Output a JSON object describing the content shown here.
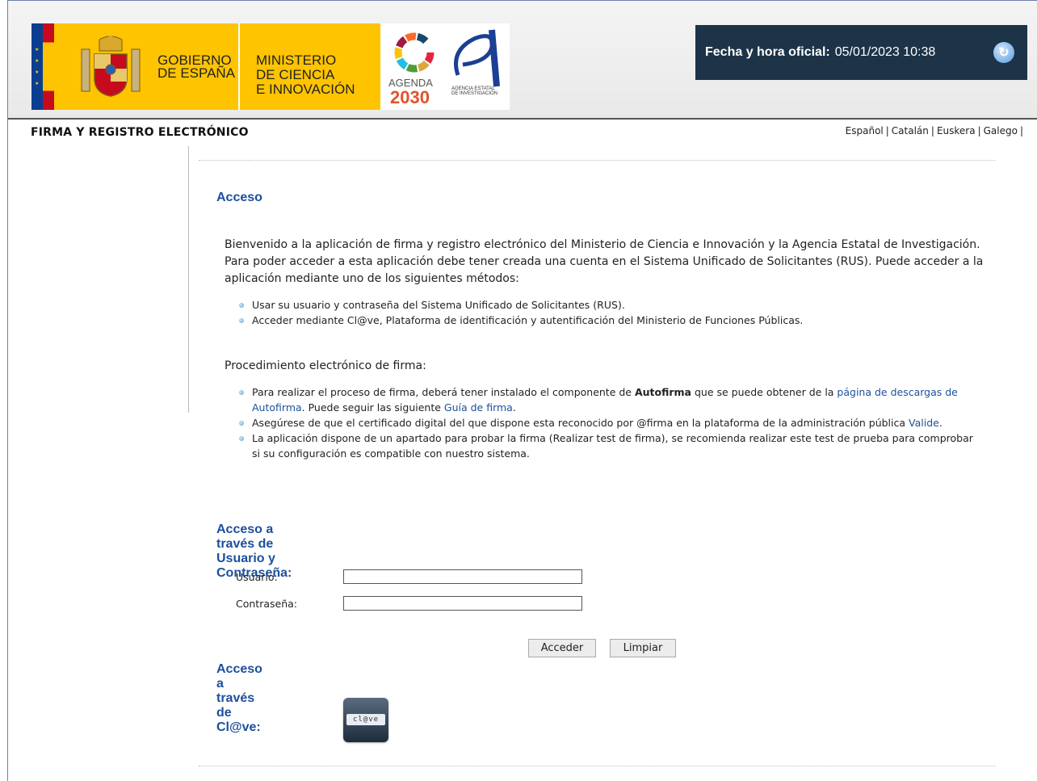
{
  "header": {
    "gobierno_line1": "GOBIERNO",
    "gobierno_line2": "DE ESPAÑA",
    "ministerio_line1": "MINISTERIO",
    "ministerio_line2": "DE CIENCIA",
    "ministerio_line3": "E INNOVACIÓN",
    "agenda_line1": "AGENDA",
    "agenda_line2": "2030",
    "aei_text": "AGENCIA ESTATAL DE INVESTIGACIÓN",
    "fecha_label": "Fecha y hora oficial:",
    "fecha_value": "05/01/2023 10:38",
    "colors": {
      "header_dark": "#1d3348",
      "brand_yellow": "#ffc400",
      "link_blue": "#1c4f9c"
    }
  },
  "title_bar": {
    "app_title": "FIRMA Y REGISTRO ELECTRÓNICO",
    "languages": [
      "Español",
      "Catalán",
      "Euskera",
      "Galego"
    ]
  },
  "main": {
    "acceso_title": "Acceso",
    "intro": "Bienvenido a la aplicación de firma y registro electrónico del Ministerio de Ciencia e Innovación y la Agencia Estatal de Investigación. Para poder acceder a esta aplicación debe tener creada una cuenta en el Sistema Unificado de Solicitantes (RUS). Puede acceder a la aplicación mediante uno de los siguientes métodos:",
    "methods": [
      "Usar su usuario y contraseña del Sistema Unificado de Solicitantes (RUS).",
      "Acceder mediante Cl@ve, Plataforma de identificación y autentificación del Ministerio de Funciones Públicas."
    ],
    "procedimiento_title": "Procedimiento electrónico de firma:",
    "proc_items": {
      "item1_a": "Para realizar el proceso de firma, deberá tener instalado el componente de ",
      "item1_bold": "Autofirma",
      "item1_b": " que se puede obtener de la ",
      "item1_link1": "página de descargas de Autofirma",
      "item1_c": ". Puede seguir las siguiente ",
      "item1_link2": "Guía de firma",
      "item1_d": ".",
      "item2_a": "Asegúrese de que el certificado digital del que dispone esta reconocido por @firma en la plataforma de la administración pública ",
      "item2_link": "Valide",
      "item2_b": ".",
      "item3": "La aplicación dispone de un apartado para probar la firma (Realizar test de firma), se recomienda realizar este test de prueba para comprobar si su configuración es compatible con nuestro sistema."
    },
    "login": {
      "title": "Acceso a través de Usuario y Contraseña:",
      "usuario_label": "Usuario:",
      "usuario_value": "",
      "password_label": "Contraseña:",
      "password_value": "",
      "acceder_label": "Acceder",
      "limpiar_label": "Limpiar"
    },
    "clave": {
      "title": "Acceso a través de Cl@ve:",
      "button_text": "cl@ve"
    }
  }
}
